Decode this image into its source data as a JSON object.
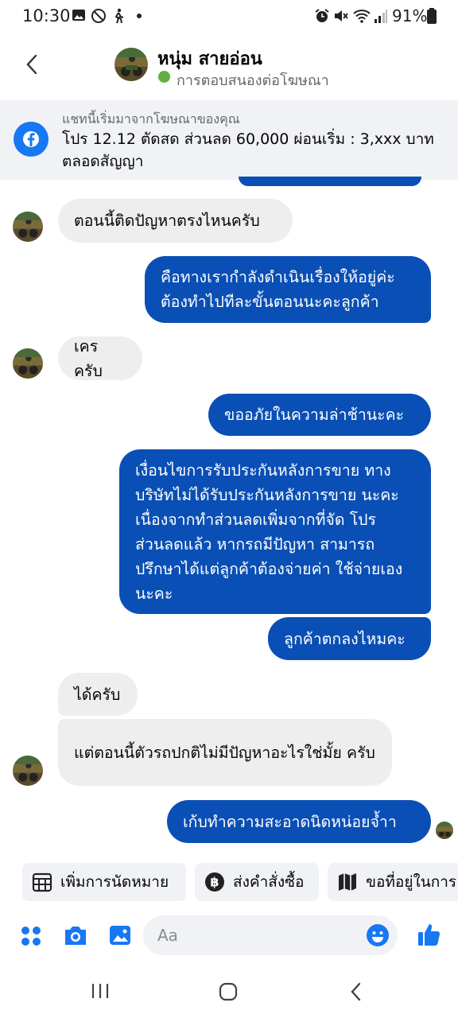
{
  "status_bar": {
    "time": "10:30",
    "battery": "91%",
    "icons": [
      "gallery-icon",
      "no-disturb-icon",
      "walking-icon",
      "dot-icon",
      "alarm-icon",
      "mute-icon",
      "wifi-icon",
      "signal-icon",
      "battery-icon"
    ]
  },
  "header": {
    "back_icon": "chevron-left-icon",
    "contact_name": "หนุ่ม สายอ่อน",
    "subtitle": "การตอบสนองต่อโฆษณา",
    "status_color": "#5fb041"
  },
  "ad_banner": {
    "caption": "แชทนี้เริ่มมาจากโฆษณาของคุณ",
    "text": "โปร 12.12 ตัดสด ส่วนลด 60,000 ผ่อนเริ่ม : 3,xxx บาท ตลอดสัญญา",
    "icon": "facebook-icon"
  },
  "messages": [
    {
      "from": "contact",
      "text": "ตอนนี้ติดปัญหาตรงไหนครับ"
    },
    {
      "from": "me",
      "text": "คือทางเรากำลังดำเนินเรื่องให้อยู่ค่ะ ต้องทำไปทีละขั้นตอนนะคะลูกค้า"
    },
    {
      "from": "contact",
      "text": "เครครับ"
    },
    {
      "from": "me",
      "text": "ขออภัยในความล่าช้านะคะ"
    },
    {
      "from": "me",
      "text": "เงื่อนไขการรับประกันหลังการขาย ทางบริษัทไม่ได้รับประกันหลังการขาย นะคะ เนื่องจากทำส่วนลดเพิ่มจากที่จัด โปรส่วนลดแล้ว หากรถมีปัญหา สามารถปรึกษาได้แต่ลูกค้าต้องจ่ายค่า ใช้จ่ายเองนะคะ"
    },
    {
      "from": "me",
      "text": "ลูกค้าตกลงไหมคะ"
    },
    {
      "from": "contact",
      "text": "ได้ครับ"
    },
    {
      "from": "contact",
      "text": "แต่ตอนนี้ตัวรถปกติไม่มีปัญหาอะไรใช่มั้ย ครับ"
    },
    {
      "from": "me",
      "text": "เก้บทำความสะอาดนิดหน่อยจ้ำา"
    }
  ],
  "quick_replies": [
    {
      "label": "เพิ่มการนัดหมาย",
      "icon": "calendar-icon"
    },
    {
      "label": "ส่งคำสั่งซื้อ",
      "icon": "baht-icon"
    },
    {
      "label": "ขอที่อยู่ในการ",
      "icon": "map-icon"
    }
  ],
  "composer": {
    "placeholder": "Aa",
    "icons": [
      "apps-icon",
      "camera-icon",
      "gallery-icon",
      "emoji-icon",
      "like-icon"
    ]
  },
  "nav_bar": {
    "icons": [
      "recents-icon",
      "home-icon",
      "back-icon"
    ]
  },
  "colors": {
    "accent": "#0a4fb5",
    "incoming_bubble": "#eeeeee",
    "banner_bg": "#f0f2f5",
    "messenger_blue": "#1877f2"
  }
}
